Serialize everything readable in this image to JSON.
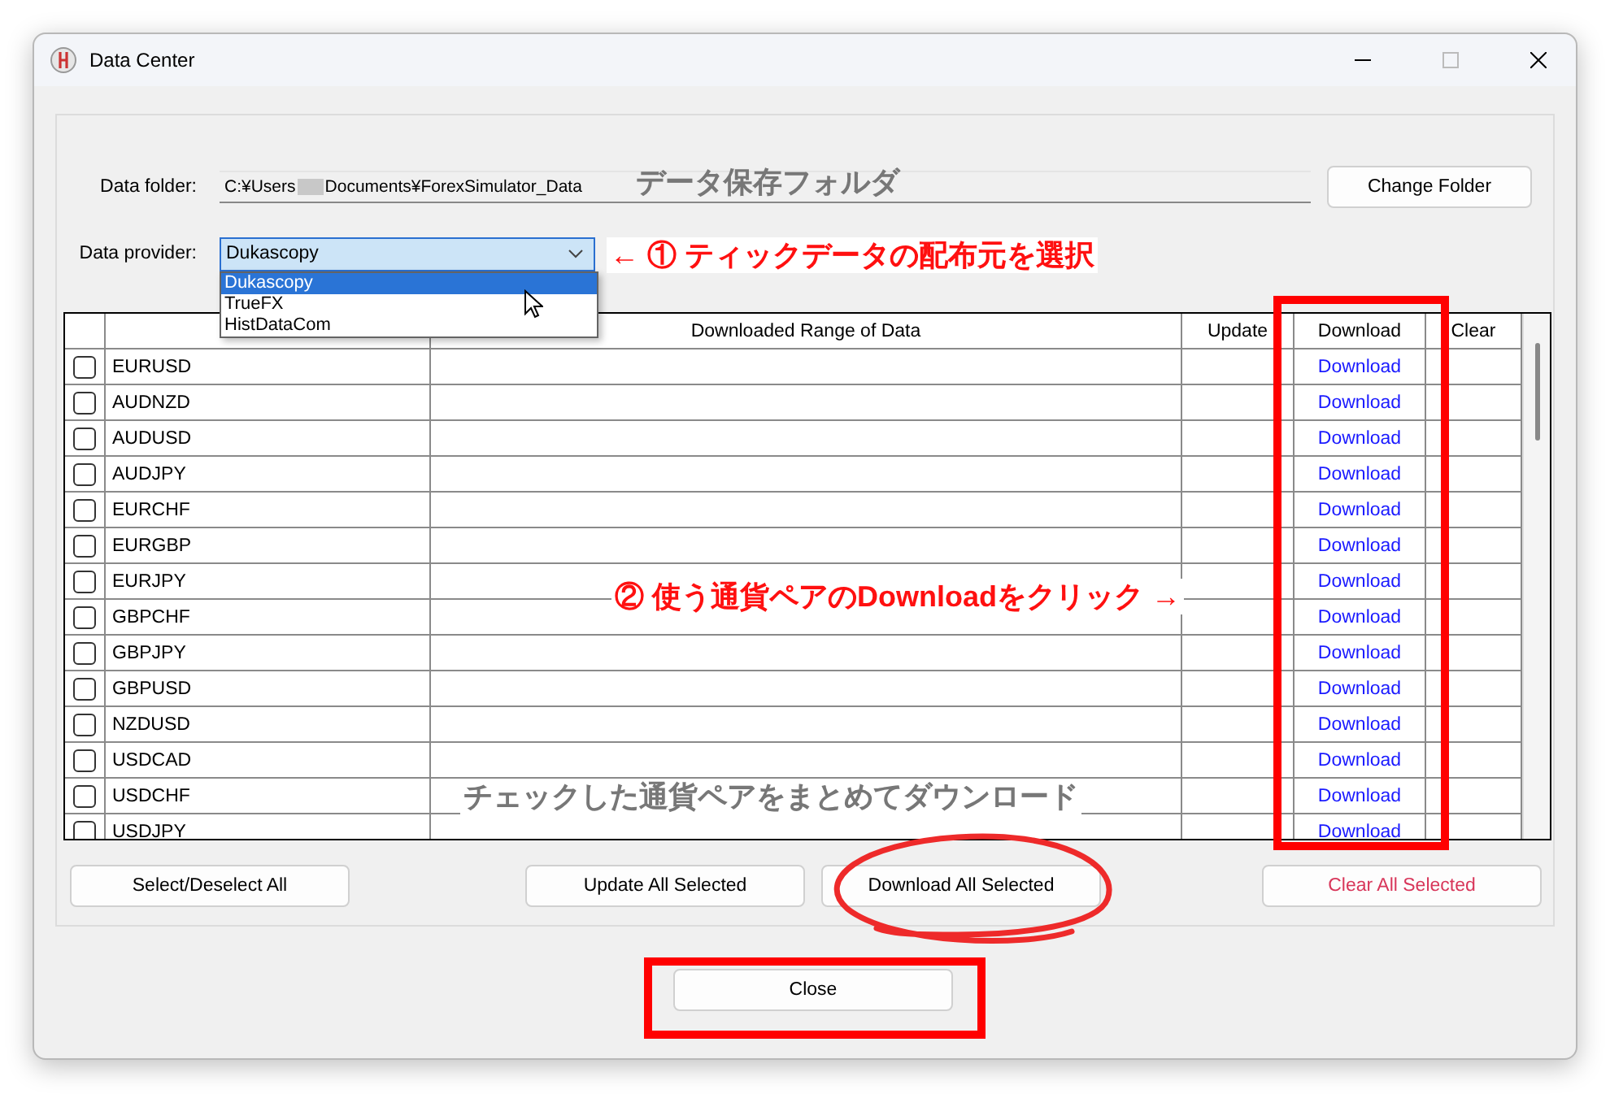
{
  "window": {
    "title": "Data Center"
  },
  "folder": {
    "label": "Data folder:",
    "path_start": "C:¥Users",
    "path_end": "Documents¥ForexSimulator_Data",
    "button": "Change Folder"
  },
  "provider": {
    "label": "Data provider:",
    "value": "Dukascopy",
    "expanded": true,
    "options": [
      {
        "label": "Dukascopy",
        "selected": true
      },
      {
        "label": "TrueFX",
        "selected": false
      },
      {
        "label": "HistDataCom",
        "selected": false
      }
    ]
  },
  "table": {
    "columns": [
      "Downloaded Range of Data",
      "Update",
      "Download",
      "Clear"
    ],
    "rows": [
      {
        "symbol": "EURUSD",
        "checked": false,
        "download": "Download"
      },
      {
        "symbol": "AUDNZD",
        "checked": false,
        "download": "Download"
      },
      {
        "symbol": "AUDUSD",
        "checked": false,
        "download": "Download"
      },
      {
        "symbol": "AUDJPY",
        "checked": false,
        "download": "Download"
      },
      {
        "symbol": "EURCHF",
        "checked": false,
        "download": "Download"
      },
      {
        "symbol": "EURGBP",
        "checked": false,
        "download": "Download"
      },
      {
        "symbol": "EURJPY",
        "checked": false,
        "download": "Download"
      },
      {
        "symbol": "GBPCHF",
        "checked": false,
        "download": "Download"
      },
      {
        "symbol": "GBPJPY",
        "checked": false,
        "download": "Download"
      },
      {
        "symbol": "GBPUSD",
        "checked": false,
        "download": "Download"
      },
      {
        "symbol": "NZDUSD",
        "checked": false,
        "download": "Download"
      },
      {
        "symbol": "USDCAD",
        "checked": false,
        "download": "Download"
      },
      {
        "symbol": "USDCHF",
        "checked": false,
        "download": "Download"
      },
      {
        "symbol": "USDJPY",
        "checked": false,
        "download": "Download"
      }
    ]
  },
  "actions": [
    {
      "label": "Select/Deselect All",
      "kind": "normal"
    },
    {
      "label": "Update All Selected",
      "kind": "normal"
    },
    {
      "label": "Download All Selected",
      "kind": "normal"
    },
    {
      "label": "Clear All Selected",
      "kind": "danger"
    }
  ],
  "close_button": "Close",
  "annotations": [
    {
      "kind": "note",
      "text": "データ保存フォルダ"
    },
    {
      "kind": "callout",
      "text": "← ① ティックデータの配布元を選択"
    },
    {
      "kind": "callout",
      "text": "② 使う通貨ペアのDownloadをクリック →"
    },
    {
      "kind": "note",
      "text": "チェックした通貨ペアをまとめてダウンロード"
    },
    {
      "kind": "box"
    },
    {
      "kind": "ellipse"
    },
    {
      "kind": "box"
    }
  ]
}
